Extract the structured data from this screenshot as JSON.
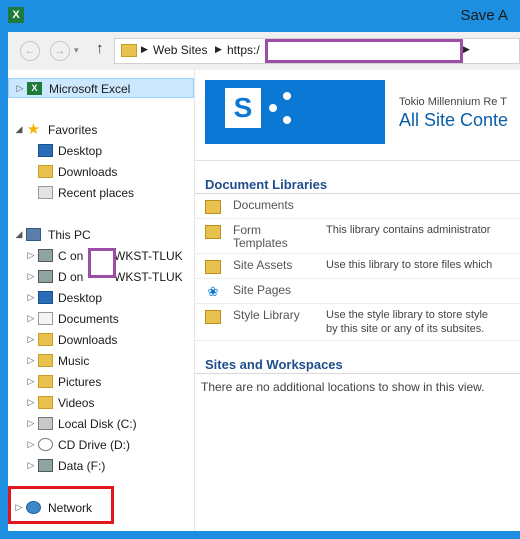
{
  "window": {
    "app_icon_glyph": "X",
    "title": "Save A"
  },
  "nav": {
    "back_icon": "back-arrow-icon",
    "forward_icon": "forward-arrow-icon",
    "up_icon": "up-arrow-icon",
    "breadcrumb": [
      "Web Sites",
      "https:/"
    ]
  },
  "tree": {
    "items": [
      {
        "label": "Microsoft Excel",
        "icon": "excel-icon"
      },
      {
        "label": "Favorites",
        "icon": "star-icon"
      },
      {
        "label": "Desktop",
        "icon": "desktop-icon"
      },
      {
        "label": "Downloads",
        "icon": "downloads-icon"
      },
      {
        "label": "Recent places",
        "icon": "recent-places-icon"
      },
      {
        "label": "This PC",
        "icon": "computer-icon"
      },
      {
        "label": "C on",
        "suffix": "WKST-TLUK",
        "icon": "network-drive-icon"
      },
      {
        "label": "D on",
        "suffix": "WKST-TLUK",
        "icon": "network-drive-icon"
      },
      {
        "label": "Desktop",
        "icon": "desktop-folder-icon"
      },
      {
        "label": "Documents",
        "icon": "documents-icon"
      },
      {
        "label": "Downloads",
        "icon": "downloads-folder-icon"
      },
      {
        "label": "Music",
        "icon": "music-icon"
      },
      {
        "label": "Pictures",
        "icon": "pictures-icon"
      },
      {
        "label": "Videos",
        "icon": "videos-icon"
      },
      {
        "label": "Local Disk (C:)",
        "icon": "local-disk-icon"
      },
      {
        "label": "CD Drive (D:)",
        "icon": "cd-drive-icon"
      },
      {
        "label": "Data (F:)",
        "icon": "data-drive-icon"
      },
      {
        "label": "Network",
        "icon": "network-icon"
      }
    ]
  },
  "site": {
    "logo_letter": "S",
    "org": "Tokio Millennium Re T",
    "title": "All Site Conte"
  },
  "libraries": {
    "heading": "Document Libraries",
    "rows": [
      {
        "name": "Documents",
        "desc": ""
      },
      {
        "name": "Form Templates",
        "desc": "This library contains administrator"
      },
      {
        "name": "Site Assets",
        "desc": "Use this library to store files which"
      },
      {
        "name": "Site Pages",
        "desc": ""
      },
      {
        "name": "Style Library",
        "desc": "Use the style library to store style",
        "desc2": "by this site or any of its subsites."
      }
    ]
  },
  "sites": {
    "heading": "Sites and Workspaces",
    "empty": "There are no additional locations to show in this view."
  },
  "colors": {
    "titlebar": "#1e8fe0",
    "sharepoint_blue": "#0a78d4",
    "redaction": "#9b4ea3",
    "highlight": "#e0161f"
  }
}
